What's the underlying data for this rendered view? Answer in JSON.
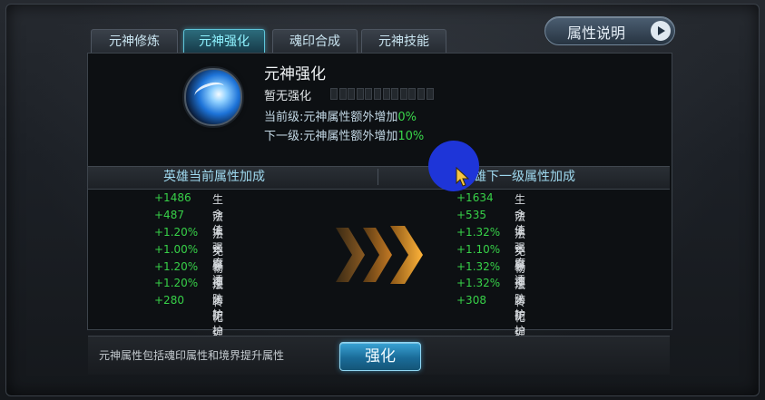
{
  "tabs": [
    {
      "label": "元神修炼",
      "active": false
    },
    {
      "label": "元神强化",
      "active": true
    },
    {
      "label": "魂印合成",
      "active": false
    },
    {
      "label": "元神技能",
      "active": false
    }
  ],
  "help_button": {
    "label": "属性说明"
  },
  "info": {
    "title": "元神强化",
    "status": "暂无强化",
    "progress": 0,
    "current_prefix": "当前级:元神属性额外增加",
    "current_value": "0%",
    "next_prefix": "下一级:元神属性额外增加",
    "next_value": "10%"
  },
  "current_stats": {
    "header": "英雄当前属性加成",
    "rows": [
      {
        "value": "+1486",
        "name": "生命值"
      },
      {
        "value": "+487",
        "name": "法术强度"
      },
      {
        "value": "+1.20%",
        "name": "法术穿透"
      },
      {
        "value": "+1.00%",
        "name": "免暴率"
      },
      {
        "value": "+1.20%",
        "name": "物理防护"
      },
      {
        "value": "+1.20%",
        "name": "法术防护"
      },
      {
        "value": "+280",
        "name": "转化强度"
      }
    ]
  },
  "next_stats": {
    "header": "英雄下一级属性加成",
    "rows": [
      {
        "value": "+1634",
        "name": "生命值"
      },
      {
        "value": "+535",
        "name": "法术强度"
      },
      {
        "value": "+1.32%",
        "name": "法术穿透"
      },
      {
        "value": "+1.10%",
        "name": "免暴率"
      },
      {
        "value": "+1.32%",
        "name": "物理防护"
      },
      {
        "value": "+1.32%",
        "name": "法术防护"
      },
      {
        "value": "+308",
        "name": "转化强度"
      }
    ]
  },
  "footer": {
    "note": "元神属性包括魂印属性和境界提升属性",
    "enhance_label": "强化"
  },
  "colors": {
    "accent": "#8ff2ff",
    "positive": "#37d148",
    "arrow": "#f0a030"
  }
}
